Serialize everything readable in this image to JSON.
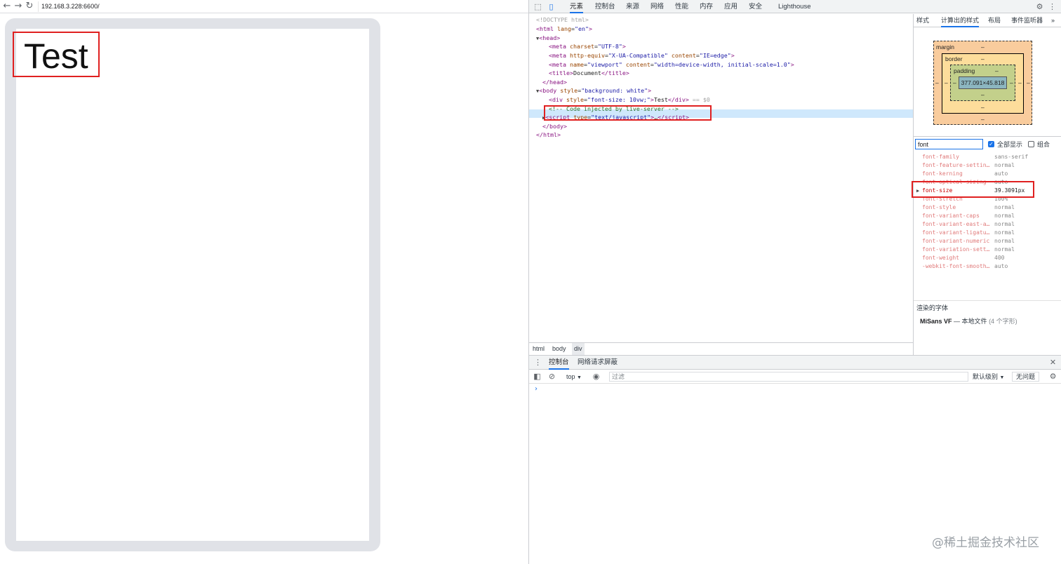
{
  "browser": {
    "url": "192.168.3.228:6600/",
    "page_text": "Test"
  },
  "devtools": {
    "tabs": [
      "元素",
      "控制台",
      "来源",
      "网络",
      "性能",
      "内存",
      "应用",
      "安全",
      "Lighthouse"
    ],
    "active_tab": "元素",
    "tree": {
      "doctype": "<!DOCTYPE html>",
      "html_open_tag": "html",
      "lang_attr": "lang",
      "lang_val": "\"en\"",
      "head": "head",
      "meta_charset_attr": "charset",
      "meta_charset_val": "\"UTF-8\"",
      "meta_http_attr": "http-equiv",
      "meta_http_val": "\"X-UA-Compatible\"",
      "meta_content_attr": "content",
      "meta_content_val": "\"IE=edge\"",
      "meta_name_attr": "name",
      "meta_name_val": "\"viewport\"",
      "meta_vp_content_val": "\"width=device-width, initial-scale=1.0\"",
      "title_text": "Document",
      "body_style_attr": "style",
      "body_style_val": "\"background: white\"",
      "div_style_val": "\"font-size: 10vw;\"",
      "div_text": "Test",
      "selected_marker": "== $0",
      "comment": "<!-- Code injected by live-server -->",
      "script_type_val": "\"text/javascript\"",
      "ellipsis": "…"
    },
    "breadcrumbs": [
      "html",
      "body",
      "div"
    ],
    "sidebar": {
      "tabs": [
        "样式",
        "计算出的样式",
        "布局",
        "事件监听器"
      ],
      "active_tab": "计算出的样式",
      "box_model": {
        "margin_label": "margin",
        "border_label": "border",
        "padding_label": "padding",
        "content_size": "377.091×45.818",
        "dash": "–"
      },
      "filter_value": "font",
      "show_all_label": "全部显示",
      "group_label": "组合",
      "properties": [
        {
          "name": "font-family",
          "value": "sans-serif"
        },
        {
          "name": "font-feature-settin…",
          "value": "normal"
        },
        {
          "name": "font-kerning",
          "value": "auto"
        },
        {
          "name": "font-optical-sizing",
          "value": "auto"
        },
        {
          "name": "font-size",
          "value": "39.3091px"
        },
        {
          "name": "font-stretch",
          "value": "100%"
        },
        {
          "name": "font-style",
          "value": "normal"
        },
        {
          "name": "font-variant-caps",
          "value": "normal"
        },
        {
          "name": "font-variant-east-a…",
          "value": "normal"
        },
        {
          "name": "font-variant-ligatu…",
          "value": "normal"
        },
        {
          "name": "font-variant-numeric",
          "value": "normal"
        },
        {
          "name": "font-variation-sett…",
          "value": "normal"
        },
        {
          "name": "font-weight",
          "value": "400"
        },
        {
          "name": "-webkit-font-smooth…",
          "value": "auto"
        }
      ],
      "rendered_fonts_title": "渲染的字体",
      "rendered_font_name": "MiSans VF",
      "rendered_font_source": "— 本地文件",
      "rendered_font_count": "(4 个字形)"
    },
    "drawer": {
      "tabs": [
        "控制台",
        "网络请求屏蔽"
      ],
      "context": "top",
      "filter_placeholder": "过滤",
      "levels": "默认级别",
      "issues": "无问题",
      "prompt": "›"
    }
  },
  "watermark": "@稀土掘金技术社区",
  "colors": {
    "highlight": "#e02020",
    "accent": "#1a73e8",
    "device_frame": "#e0e2e7"
  }
}
